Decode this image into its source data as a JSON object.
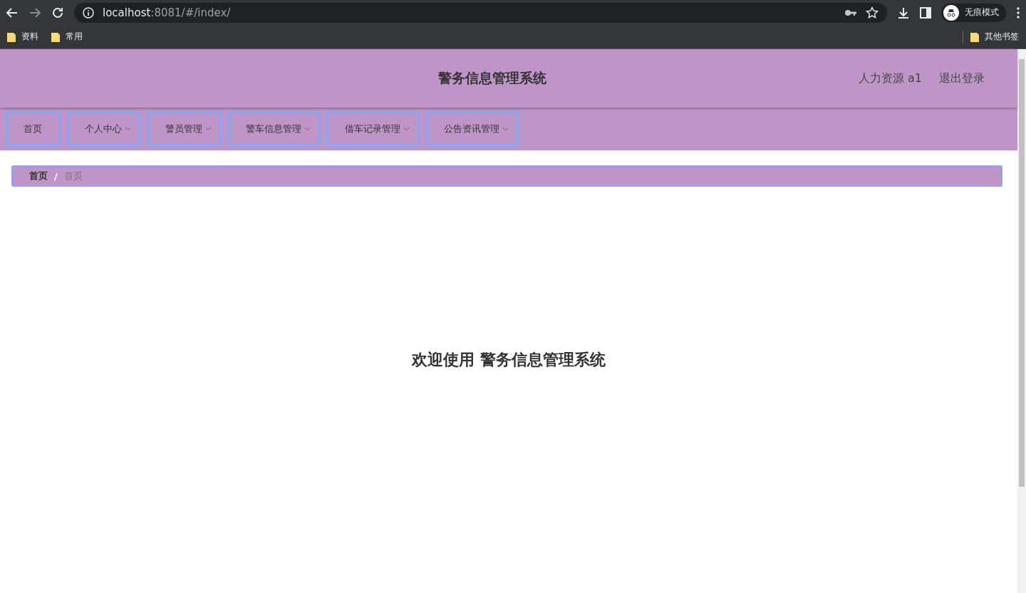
{
  "browser": {
    "url_host": "localhost",
    "url_rest": ":8081/#/index/",
    "profile": "无痕模式",
    "bookmarks": [
      "资料",
      "常用"
    ],
    "other_bookmarks": "其他书签"
  },
  "header": {
    "title": "警务信息管理系统",
    "user": "人力资源 a1",
    "logout": "退出登录"
  },
  "menu": [
    {
      "label": "首页",
      "kind": "link"
    },
    {
      "label": "个人中心",
      "kind": "dropdown"
    },
    {
      "label": "警员管理",
      "kind": "dropdown"
    },
    {
      "label": "警车信息管理",
      "kind": "dropdown"
    },
    {
      "label": "借车记录管理",
      "kind": "dropdown"
    },
    {
      "label": "公告资讯管理",
      "kind": "dropdown"
    }
  ],
  "breadcrumb_separator": "/",
  "breadcrumb": [
    {
      "label": "首页",
      "kind": "link"
    },
    {
      "label": "首页",
      "kind": "current"
    }
  ],
  "welcome": "欢迎使用 警务信息管理系统"
}
